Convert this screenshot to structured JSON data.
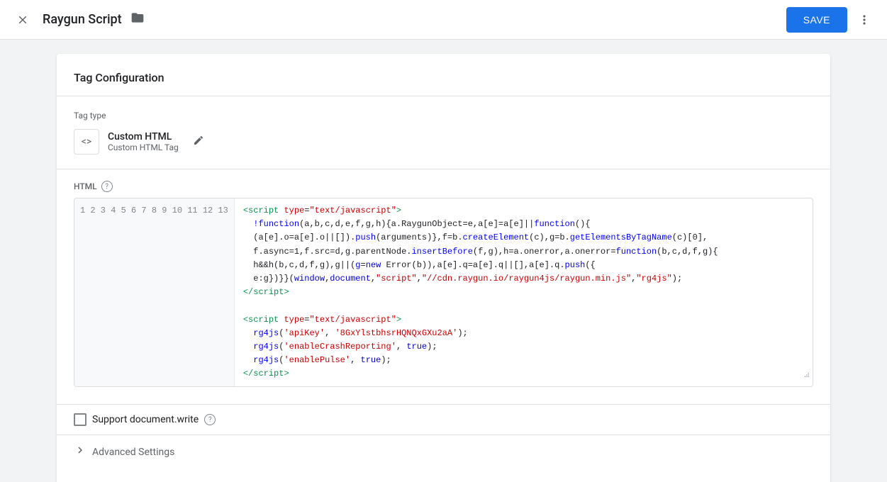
{
  "toolbar": {
    "title": "Raygun Script",
    "save_label": "SAVE"
  },
  "card": {
    "title": "Tag Configuration",
    "tag_type_label": "Tag type",
    "tag_name": "Custom HTML",
    "tag_sub": "Custom HTML Tag",
    "html_label": "HTML",
    "code_lines": [
      {
        "num": "1",
        "html": "<span class='c-tag'>&lt;script</span> <span class='c-attr'>type</span>=<span class='c-str'>\"text/javascript\"</span><span class='c-tag'>&gt;</span>"
      },
      {
        "num": "2",
        "html": "  <span class='c-fn'>!function</span>(a,b,c,d,e,f,g,h){a.RaygunObject=e,a[e]=a[e]||<span class='c-fn'>function</span>(){"
      },
      {
        "num": "3",
        "html": "  (a[e].o=a[e].o||[]).<span class='c-fn'>push</span>(arguments)},f=b.<span class='c-fn'>createElement</span>(c),g=b.<span class='c-fn'>getElementsByTagName</span>(c)[0],"
      },
      {
        "num": "4",
        "html": "  f.async=1,f.src=d,g.parentNode.<span class='c-fn'>insertBefore</span>(f,g),h=a.onerror,a.onerror=<span class='c-fn'>function</span>(b,c,d,f,g){"
      },
      {
        "num": "5",
        "html": "  h&amp;&amp;h(b,c,d,f,g),g||(<span class='c-keyword'>g</span>=<span class='c-keyword'>new</span> Error(b)),a[e].q=a[e].q||[],a[e].q.<span class='c-fn'>push</span>({"
      },
      {
        "num": "6",
        "html": "  e:g})}}(<span class='c-keyword'>window</span>,<span class='c-keyword'>document</span>,<span class='c-str'>\"script\"</span>,<span class='c-str'>\"//cdn.raygun.io/raygun4js/raygun.min.js\"</span>,<span class='c-str'>\"rg4js\"</span>);"
      },
      {
        "num": "7",
        "html": "<span class='c-close-tag'>&lt;/script&gt;</span>"
      },
      {
        "num": "8",
        "html": ""
      },
      {
        "num": "9",
        "html": "<span class='c-tag'>&lt;script</span> <span class='c-attr'>type</span>=<span class='c-str'>\"text/javascript\"</span><span class='c-tag'>&gt;</span>"
      },
      {
        "num": "10",
        "html": "  <span class='c-fn'>rg4js</span>(<span class='c-str'>'apiKey'</span>, <span class='c-str'>'8GxYlstbhsrHQNQxGXu2aA'</span>);"
      },
      {
        "num": "11",
        "html": "  <span class='c-fn'>rg4js</span>(<span class='c-str'>'enableCrashReporting'</span>, <span class='c-bool'>true</span>);"
      },
      {
        "num": "12",
        "html": "  <span class='c-fn'>rg4js</span>(<span class='c-str'>'enablePulse'</span>, <span class='c-bool'>true</span>);"
      },
      {
        "num": "13",
        "html": "<span class='c-close-tag'>&lt;/script&gt;</span>"
      }
    ],
    "support_label": "Support document.write",
    "advanced_label": "Advanced Settings"
  }
}
